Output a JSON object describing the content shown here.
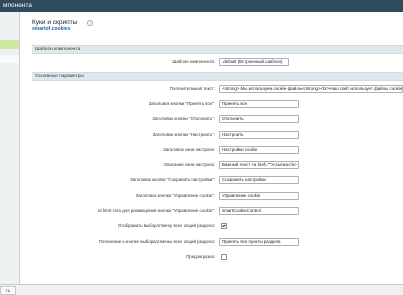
{
  "window": {
    "title": "мпонента"
  },
  "page": {
    "title": "Куки и скрипты",
    "help": "i",
    "subtitle": "smartof.cookies"
  },
  "bottom": {
    "button": "ть"
  },
  "sections": {
    "template": "Шаблон компонента",
    "params": "Основные параметры"
  },
  "template_row": {
    "label": "Шаблон компонента:",
    "value": ".default (Встроенный шаблон)"
  },
  "fields": [
    {
      "label": "Пояснительный текст:",
      "value": "<strong> Мы используем cookie-файлы</strong><br>Наш сайт использует файлы cookie: техническ"
    },
    {
      "label": "Заголовок кнопки \"Принять все\":",
      "value": "Принять все"
    },
    {
      "label": "Заголовок кнопки \"Отклонить\":",
      "value": "Отклонить"
    },
    {
      "label": "Заголовок кнопки \"Настроить\":",
      "value": "Настроить"
    },
    {
      "label": "Заголовок окна настроек:",
      "value": "Настройки cookie"
    },
    {
      "label": "Описание окна настроек:",
      "value": "Важный текст <a href=\"\">ссылка</a>"
    },
    {
      "label": "Заголовок кнопки \"Сохранить настройки\":",
      "value": "Сохранить настройки"
    },
    {
      "label": "Заголовок кнопки \"Управление cookie\":",
      "value": "Управление cookie"
    },
    {
      "label": "Id html-тега для размещения кнопки \"Управление cookie\":",
      "value": "smartCookieControl"
    }
  ],
  "checkbox_all": {
    "label": "Отображать выбор/отмену всех опций раздела:",
    "checked": true
  },
  "explain_row": {
    "label": "Пояснение к кнопке выбора/отмены всех опций раздела:",
    "value": "Принять все пункты раздела"
  },
  "preview_row": {
    "label": "Предзагрузка:",
    "checked": false
  }
}
